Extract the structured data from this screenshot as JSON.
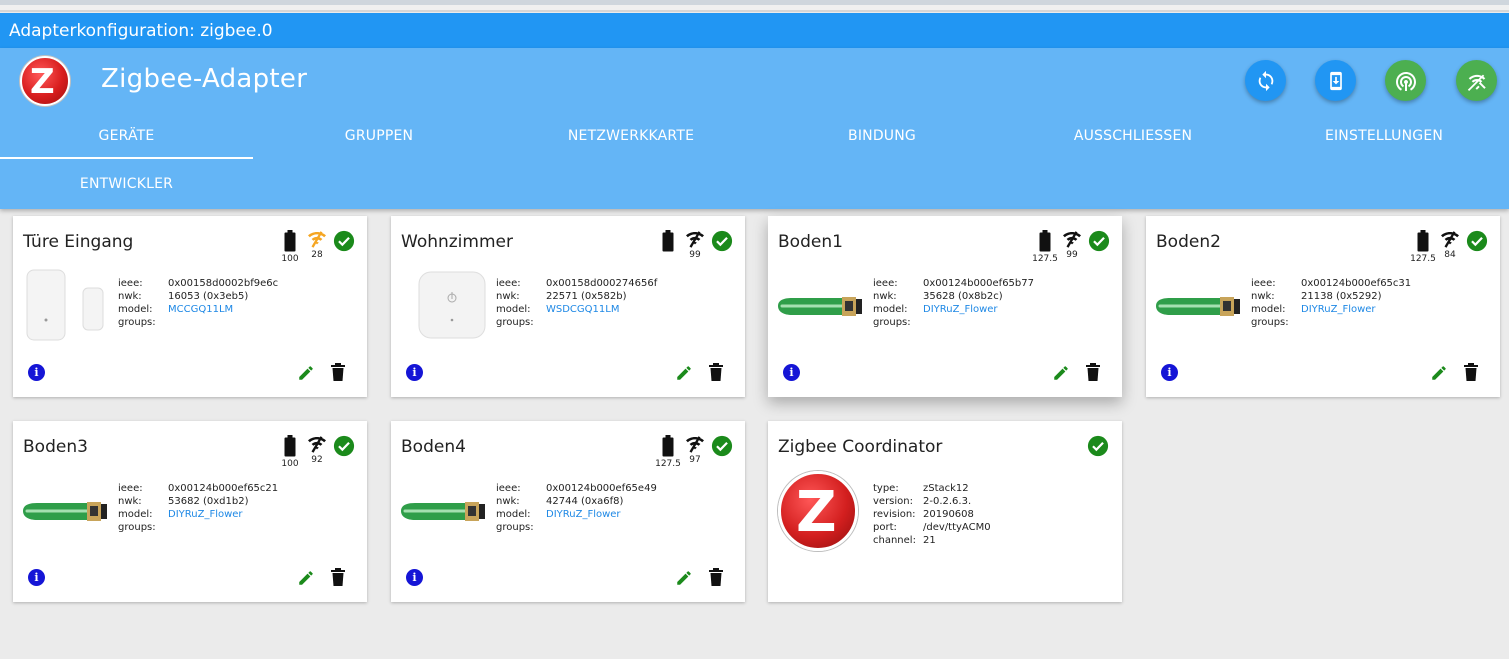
{
  "window": {
    "title": "Adapterkonfiguration: zigbee.0"
  },
  "header": {
    "title": "Zigbee-Adapter",
    "buttons": [
      {
        "icon": "refresh-icon",
        "color": "#2196f3"
      },
      {
        "icon": "download-device-icon",
        "color": "#2196f3"
      },
      {
        "icon": "pairing-icon",
        "color": "#4caf50"
      },
      {
        "icon": "touchlink-icon",
        "color": "#4caf50"
      }
    ]
  },
  "tabs": [
    {
      "label": "GERÄTE",
      "active": true
    },
    {
      "label": "GRUPPEN"
    },
    {
      "label": "NETZWERKKARTE"
    },
    {
      "label": "BINDUNG"
    },
    {
      "label": "AUSSCHLIESSEN"
    },
    {
      "label": "EINSTELLUNGEN"
    },
    {
      "label": "ENTWICKLER"
    }
  ],
  "colors": {
    "accent": "#2196f3",
    "header": "#64b5f6",
    "ok": "#1b8a1b",
    "weak_link": "#f5a623",
    "link": "#1e88e5"
  },
  "labels": {
    "ieee": "ieee:",
    "nwk": "nwk:",
    "model": "model:",
    "groups": "groups:",
    "type": "type:",
    "version": "version:",
    "revision": "revision:",
    "port": "port:",
    "channel": "channel:",
    "info_glyph": "i"
  },
  "devices": [
    {
      "name": "Türe Eingang",
      "battery": "100",
      "link": "28",
      "link_weak": true,
      "ieee": "0x00158d0002bf9e6c",
      "nwk": "16053 (0x3eb5)",
      "model": "MCCGQ11LM",
      "groups": "",
      "image": "door-sensor"
    },
    {
      "name": "Wohnzimmer",
      "battery": "",
      "link": "99",
      "ieee": "0x00158d000274656f",
      "nwk": "22571 (0x582b)",
      "model": "WSDCGQ11LM",
      "groups": "",
      "image": "temp-sensor"
    },
    {
      "name": "Boden1",
      "battery": "127.5",
      "link": "99",
      "ieee": "0x00124b000ef65b77",
      "nwk": "35628 (0x8b2c)",
      "model": "DIYRuZ_Flower",
      "groups": "",
      "image": "soil-sensor"
    },
    {
      "name": "Boden2",
      "battery": "127.5",
      "link": "84",
      "ieee": "0x00124b000ef65c31",
      "nwk": "21138 (0x5292)",
      "model": "DIYRuZ_Flower",
      "groups": "",
      "image": "soil-sensor"
    },
    {
      "name": "Boden3",
      "battery": "100",
      "link": "92",
      "ieee": "0x00124b000ef65c21",
      "nwk": "53682 (0xd1b2)",
      "model": "DIYRuZ_Flower",
      "groups": "",
      "image": "soil-sensor"
    },
    {
      "name": "Boden4",
      "battery": "127.5",
      "link": "97",
      "ieee": "0x00124b000ef65e49",
      "nwk": "42744 (0xa6f8)",
      "model": "DIYRuZ_Flower",
      "groups": "",
      "image": "soil-sensor"
    }
  ],
  "coordinator": {
    "name": "Zigbee Coordinator",
    "type": "zStack12",
    "version": "2-0.2.6.3.",
    "revision": "20190608",
    "port": "/dev/ttyACM0",
    "channel": "21"
  }
}
